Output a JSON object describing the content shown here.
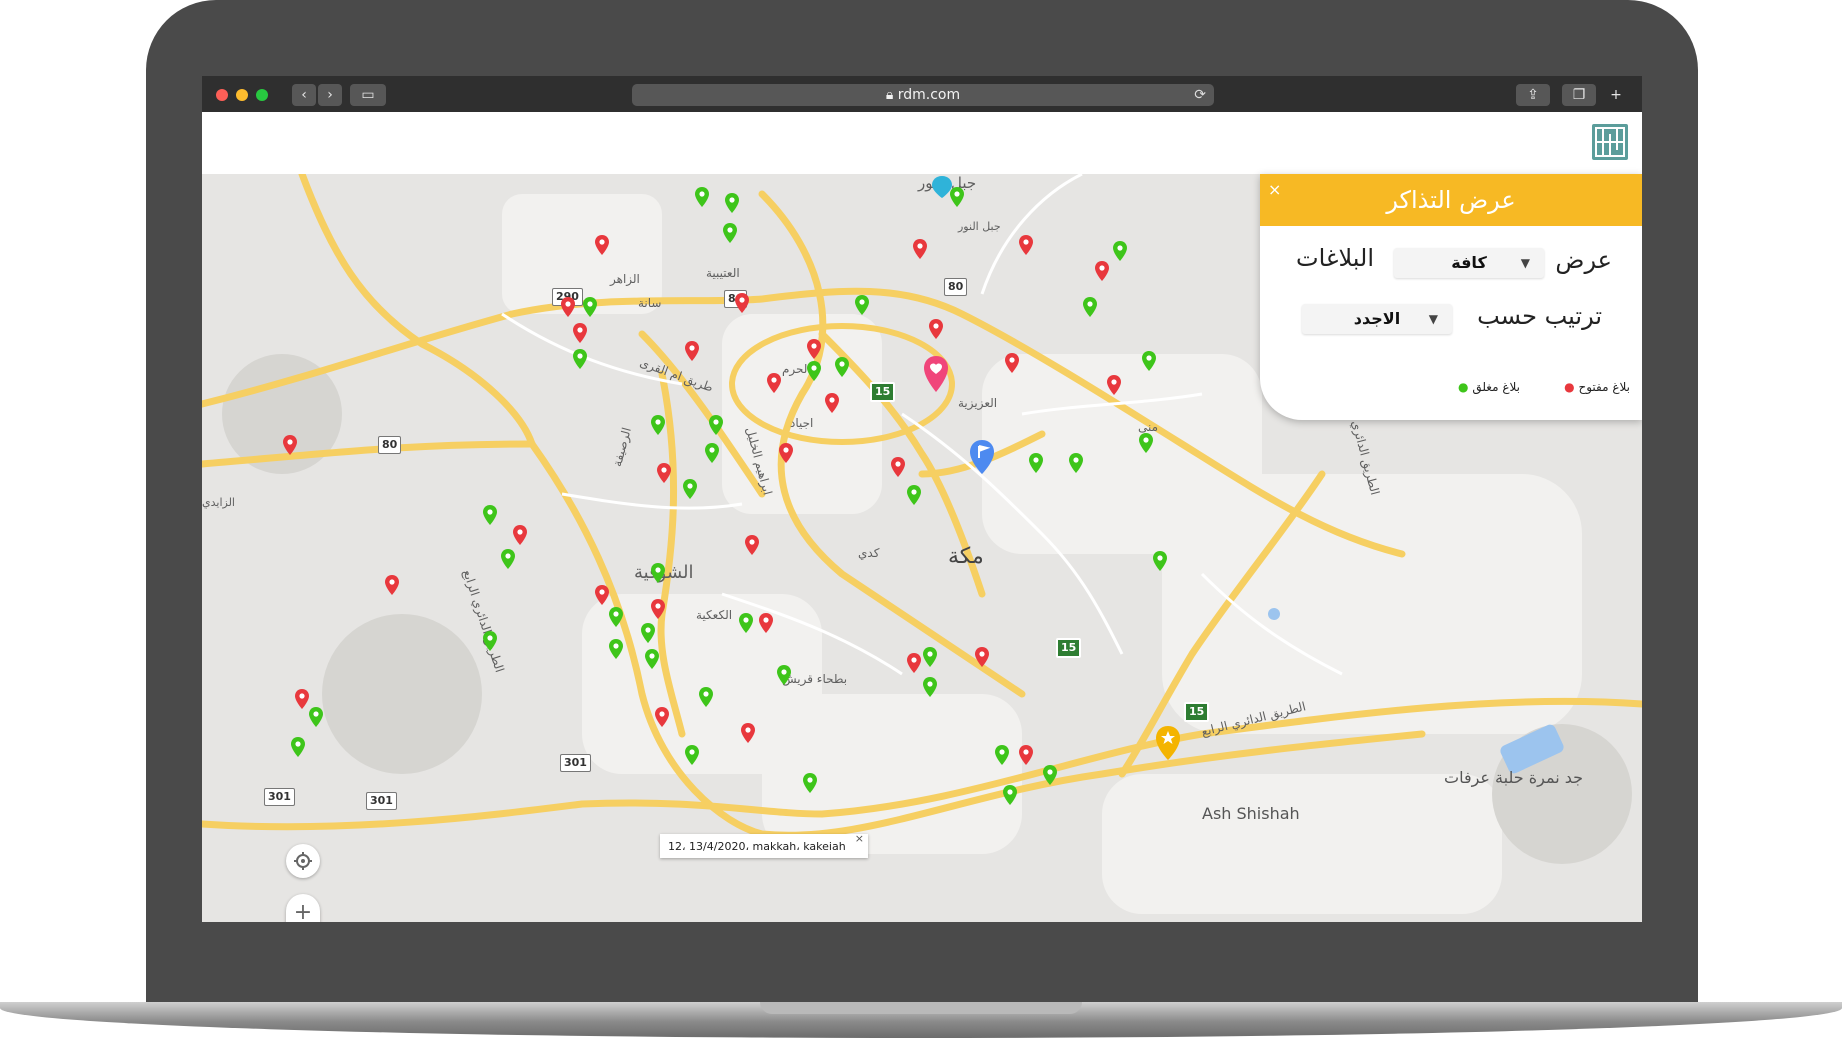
{
  "browser": {
    "url": "rdm.com",
    "lock_icon": "lock-icon",
    "colors": {
      "close": "#fc5f57",
      "minimize": "#fdbc2e",
      "maximize": "#28c840"
    }
  },
  "panel": {
    "title": "عرض التذاكر",
    "close": "×",
    "show_label": "عرض",
    "show_select": "كافة",
    "reports_label": "البلاغات",
    "sort_label": "ترتيب حسب",
    "sort_select": "الاجدد",
    "legend_open": "بلاغ مفتوح",
    "legend_closed": "بلاغ مغلق",
    "accent": "#f7b924"
  },
  "map": {
    "places": {
      "jabal_noor": "جبل النور",
      "jabal_noor_small": "جبل النور",
      "zaher": "الزاهر",
      "otaibiya": "العتيبية",
      "haram": "الحرم",
      "ajyad": "اجياد",
      "aziziya": "العزيزية",
      "mina": "منى",
      "makkah": "مكة",
      "kudai": "كدي",
      "shawqiya": "الشوقية",
      "kakiya": "الكعكية",
      "bathaa_quraish": "بطحاء قريش",
      "ash_shishah": "Ash Shishah",
      "namira": "جد نمرة حلبة عرفات",
      "zaidi": "الزايدي",
      "usaifa": "سانة",
      "umm_alqura": "طريق ام القرى",
      "rusaifa": "الرصيفة",
      "ibrahim": "ابراهيم الخليل",
      "ring_road": "الطريق الدائري الرابع"
    },
    "shields": [
      "290",
      "80",
      "80",
      "80",
      "15",
      "15",
      "15",
      "301",
      "301",
      "301"
    ],
    "tooltip_text": "12، 13/4/2020، makkah، kakeiah",
    "tooltip_close": "×",
    "zoom_in": "+",
    "zoom_out": "-",
    "pin_colors": {
      "open": "#e8383d",
      "closed": "#3ec51a"
    }
  }
}
